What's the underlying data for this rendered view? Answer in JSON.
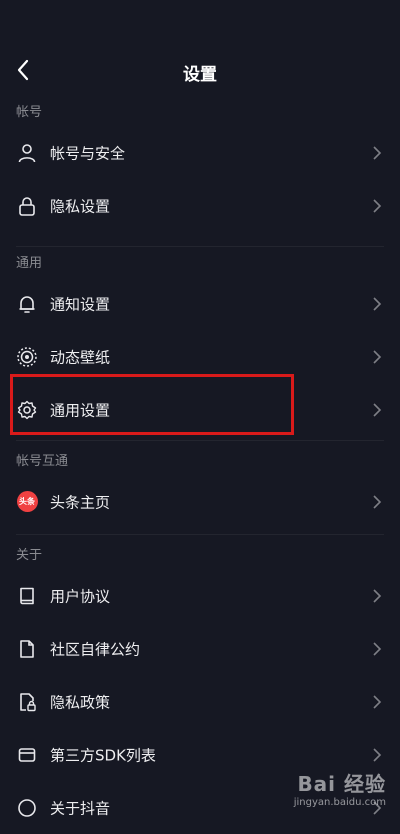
{
  "header": {
    "title": "设置",
    "back_icon": "back-arrow-icon"
  },
  "sections": [
    {
      "title": "帐号",
      "items": [
        {
          "label": "帐号与安全",
          "icon": "person-icon"
        },
        {
          "label": "隐私设置",
          "icon": "lock-icon"
        }
      ]
    },
    {
      "title": "通用",
      "items": [
        {
          "label": "通知设置",
          "icon": "bell-icon"
        },
        {
          "label": "动态壁纸",
          "icon": "wallpaper-icon"
        },
        {
          "label": "通用设置",
          "icon": "gear-icon",
          "highlighted": true
        }
      ]
    },
    {
      "title": "帐号互通",
      "items": [
        {
          "label": "头条主页",
          "icon": "toutiao-logo-icon",
          "badge_text": "头条"
        }
      ]
    },
    {
      "title": "关于",
      "items": [
        {
          "label": "用户协议",
          "icon": "book-icon"
        },
        {
          "label": "社区自律公约",
          "icon": "document-icon"
        },
        {
          "label": "隐私政策",
          "icon": "privacy-document-icon"
        },
        {
          "label": "第三方SDK列表",
          "icon": "card-icon"
        },
        {
          "label": "关于抖音",
          "icon": "info-icon"
        }
      ]
    }
  ],
  "watermark": {
    "main": "Bai 经验",
    "sub": "jingyan.baidu.com"
  },
  "colors": {
    "background": "#161823",
    "highlight_border": "#d91a1a",
    "section_title": "#8a8b91"
  }
}
